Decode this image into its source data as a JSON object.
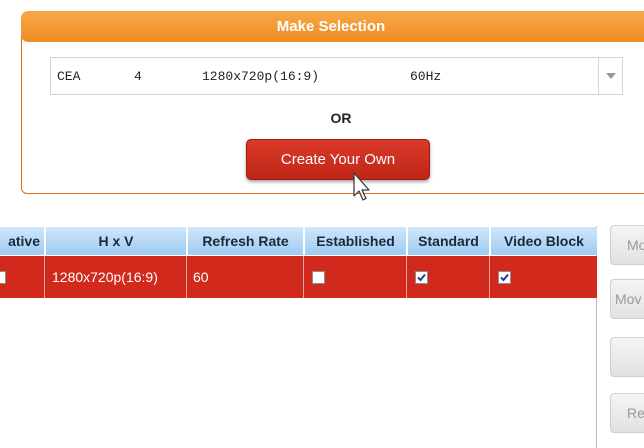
{
  "selection": {
    "title": "Make Selection",
    "dropdown": {
      "standard": "CEA",
      "id": "4",
      "resolution": "1280x720p(16:9)",
      "refresh": "60Hz"
    },
    "or_label": "OR",
    "create_button": "Create Your Own"
  },
  "table": {
    "headers": [
      "ative",
      "H x V",
      "Refresh Rate",
      "Established",
      "Standard",
      "Video Block"
    ],
    "rows": [
      {
        "hxv": "1280x720p(16:9)",
        "refresh_rate": "60",
        "established": false,
        "standard": true,
        "video_block": true
      }
    ]
  },
  "side_buttons": [
    "Mo",
    "Mov",
    "",
    "Re"
  ],
  "colors": {
    "header_orange": "#ef8d21",
    "button_red": "#c7281a",
    "row_selected": "#d1291c",
    "table_header_blue": "#a8d0f4"
  }
}
